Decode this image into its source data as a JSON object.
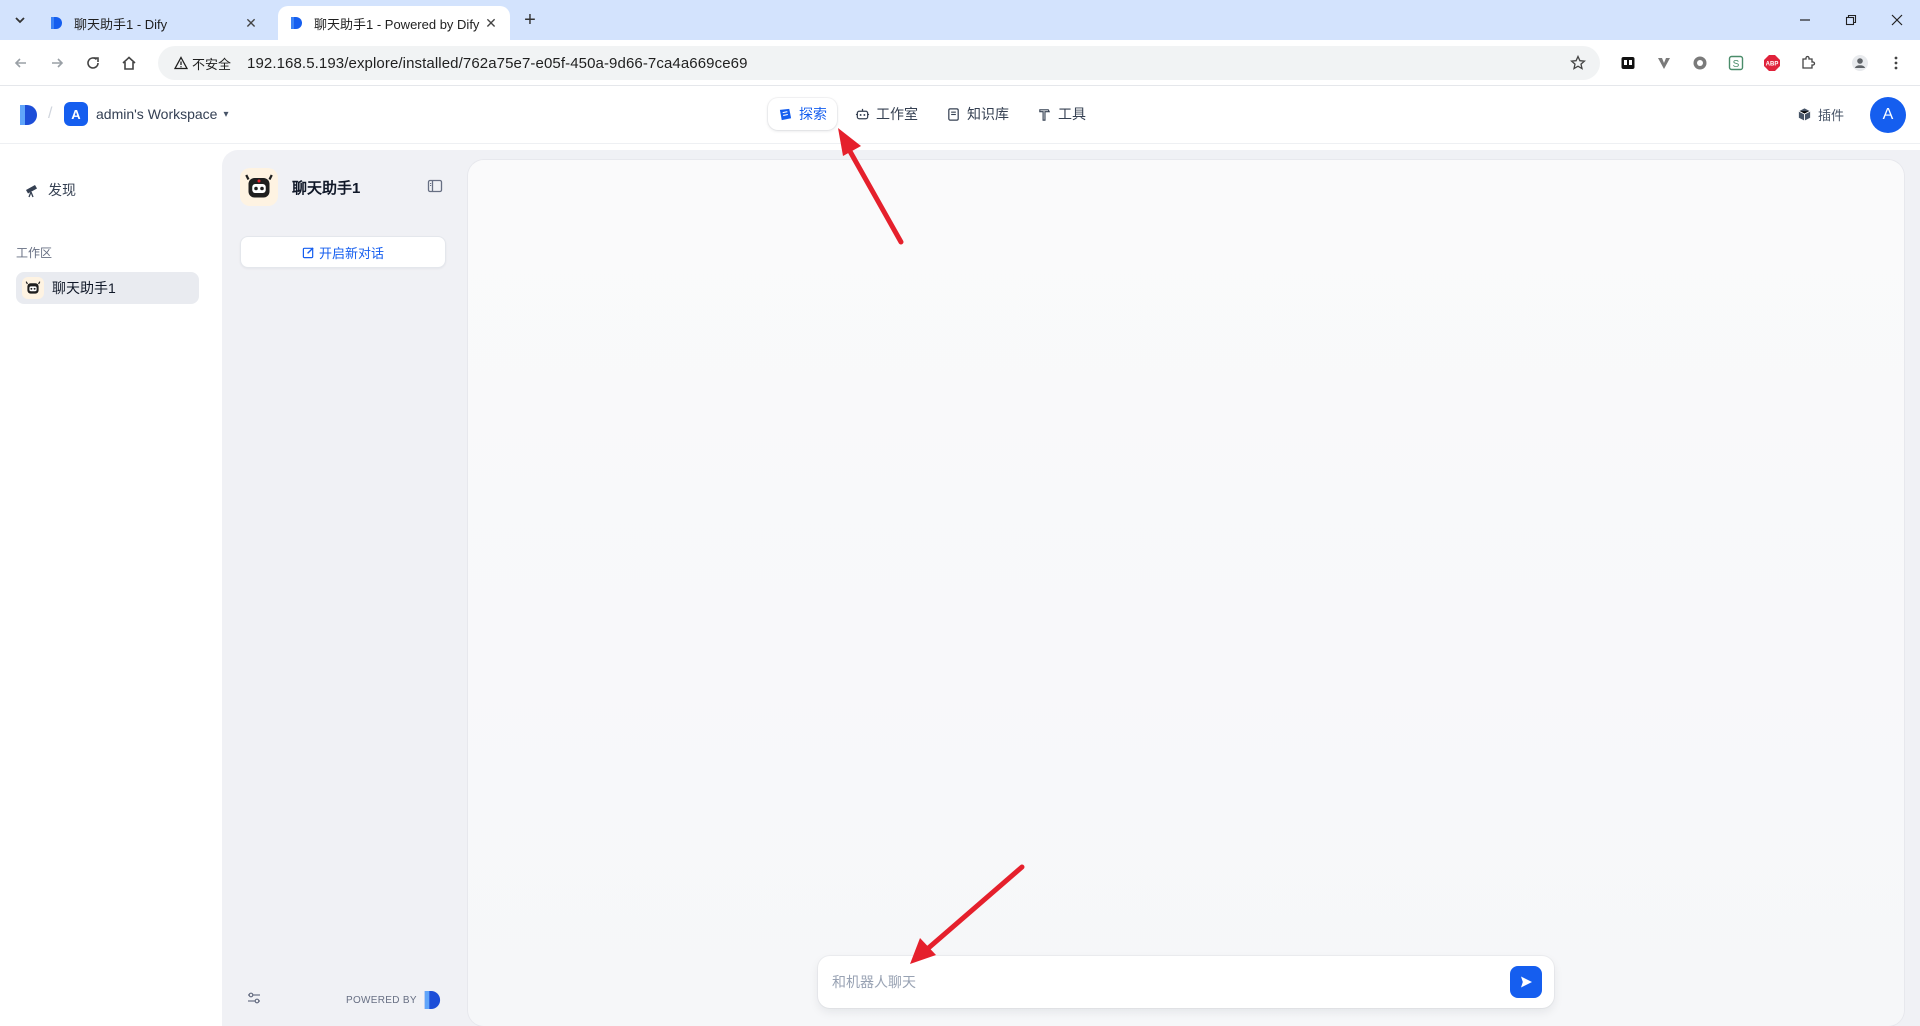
{
  "browser": {
    "tabs": [
      {
        "title": "聊天助手1 - Dify",
        "active": false
      },
      {
        "title": "聊天助手1 - Powered by Dify",
        "active": true
      }
    ],
    "security_label": "不安全",
    "url": "192.168.5.193/explore/installed/762a75e7-e05f-450a-9d66-7ca4a669ce69",
    "extensions": [
      "notion-icon",
      "vimium-icon",
      "circle-ext-icon",
      "s-ext-icon",
      "adblock-icon",
      "puzzle-icon",
      "profile-icon",
      "kebab-menu-icon"
    ]
  },
  "header": {
    "workspace_initial": "A",
    "workspace_name": "admin's Workspace",
    "nav": [
      {
        "label": "探索",
        "active": true,
        "icon": "explore-icon"
      },
      {
        "label": "工作室",
        "active": false,
        "icon": "robot-icon"
      },
      {
        "label": "知识库",
        "active": false,
        "icon": "book-icon"
      },
      {
        "label": "工具",
        "active": false,
        "icon": "hammer-icon"
      }
    ],
    "plugin_label": "插件",
    "user_initial": "A"
  },
  "sidebar": {
    "discover_label": "发现",
    "section_label": "工作区",
    "apps": [
      {
        "name": "聊天助手1",
        "selected": true
      }
    ]
  },
  "chat": {
    "app_name": "聊天助手1",
    "new_chat_label": "开启新对话",
    "powered_by": "POWERED BY",
    "input_placeholder": "和机器人聊天"
  },
  "colors": {
    "accent": "#155eef",
    "annotation_arrow": "#e5202c"
  }
}
